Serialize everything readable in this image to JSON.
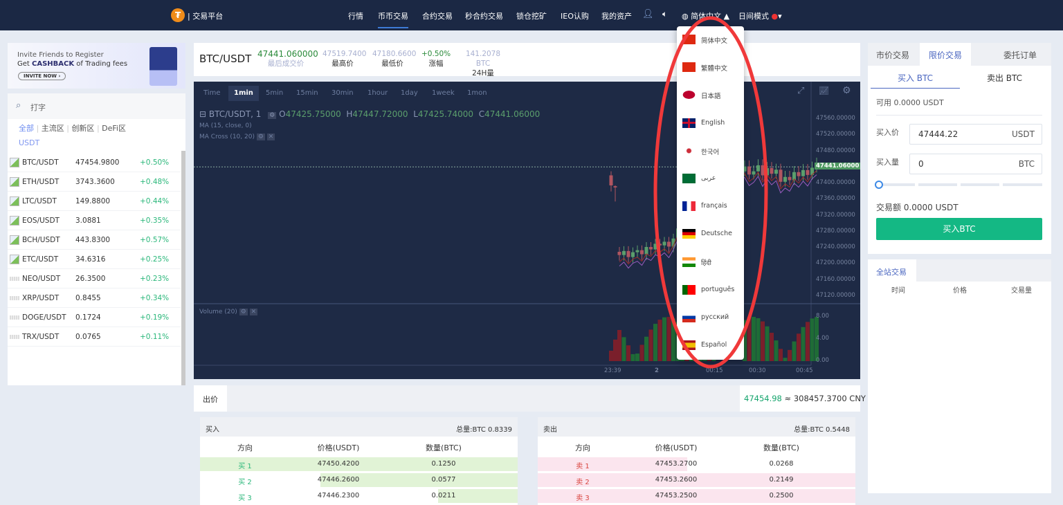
{
  "nav": {
    "brand": "| 交易平台",
    "logo_glyph": "₮",
    "items": [
      "行情",
      "币币交易",
      "合约交易",
      "秒合约交易",
      "锁仓挖矿",
      "IEO认购",
      "我的资产"
    ],
    "active": 1,
    "language": "简体中文",
    "theme": "日间模式"
  },
  "banner": {
    "line1": "Invite Friends to Register",
    "line2_pre": "Get ",
    "line2_bold": "CASHBACK",
    "line2_post": " of Trading fees",
    "button": "INVITE NOW ›"
  },
  "market": {
    "search_placeholder": "打字",
    "tabs": [
      "全部",
      "主流区",
      "创新区",
      "DeFi区",
      "USDT"
    ],
    "active_tab": 0,
    "rows": [
      {
        "pair": "BTC/USDT",
        "price": "47454.9800",
        "change": "+0.50%",
        "icon": "broken"
      },
      {
        "pair": "ETH/USDT",
        "price": "3743.3600",
        "change": "+0.48%",
        "icon": "broken"
      },
      {
        "pair": "LTC/USDT",
        "price": "149.8800",
        "change": "+0.44%",
        "icon": "broken"
      },
      {
        "pair": "EOS/USDT",
        "price": "3.0881",
        "change": "+0.35%",
        "icon": "broken"
      },
      {
        "pair": "BCH/USDT",
        "price": "443.8300",
        "change": "+0.57%",
        "icon": "broken"
      },
      {
        "pair": "ETC/USDT",
        "price": "34.6316",
        "change": "+0.25%",
        "icon": "broken"
      },
      {
        "pair": "NEO/USDT",
        "price": "26.3500",
        "change": "+0.23%",
        "icon": "blurred"
      },
      {
        "pair": "XRP/USDT",
        "price": "0.8455",
        "change": "+0.34%",
        "icon": "blurred"
      },
      {
        "pair": "DOGE/USDT",
        "price": "0.1724",
        "change": "+0.19%",
        "icon": "blurred"
      },
      {
        "pair": "TRX/USDT",
        "price": "0.0765",
        "change": "+0.11%",
        "icon": "blurred"
      }
    ]
  },
  "ticker": {
    "pair": "BTC/USDT",
    "last": "47441.060000",
    "last_label": "最后成交价",
    "high": "47519.7400",
    "high_label": "最高价",
    "low": "47180.6600",
    "low_label": "最低价",
    "change": "+0.50%",
    "change_label": "涨幅",
    "volume": "141.2078 BTC",
    "volume_label": "24H量"
  },
  "chart": {
    "timeframes": [
      "Time",
      "1min",
      "5min",
      "15min",
      "30min",
      "1hour",
      "1day",
      "1week",
      "1mon"
    ],
    "active_tf": 1,
    "legend_title": "BTC/USDT, 1",
    "o": "47425.75000",
    "h": "47447.72000",
    "l": "47425.74000",
    "c": "47441.06000",
    "ma": "MA (15, close, 0)",
    "ma_cross": "MA Cross (10, 20)",
    "volume_label": "Volume (20)",
    "price_ticks": [
      "47560.00000",
      "47520.00000",
      "47480.00000",
      "47441.06000",
      "47400.00000",
      "47360.00000",
      "47320.00000",
      "47280.00000",
      "47240.00000",
      "47200.00000",
      "47160.00000",
      "47120.00000"
    ],
    "volume_ticks": [
      "8.00",
      "4.00",
      "0.00"
    ],
    "time_ticks": [
      "23:39",
      "2",
      "00:15",
      "00:30",
      "00:45"
    ],
    "current_price": 47441.06,
    "up_color": "#5b9e6c",
    "down_color": "#b05560"
  },
  "orderbook": {
    "label": "出价",
    "price": "47454.98",
    "cny": "≈ 308457.3700 CNY",
    "buy": {
      "title": "买入",
      "total": "总量:BTC 0.8339",
      "cols": [
        "方向",
        "价格(USDT)",
        "数量(BTC)"
      ],
      "rows": [
        {
          "side": "买 1",
          "price": "47450.4200",
          "qty": "0.1250",
          "depth": 1.0
        },
        {
          "side": "买 2",
          "price": "47446.2600",
          "qty": "0.0577",
          "depth": 0.62
        },
        {
          "side": "买 3",
          "price": "47446.2300",
          "qty": "0.0211",
          "depth": 0.25
        }
      ]
    },
    "sell": {
      "title": "卖出",
      "total": "总量:BTC 0.5448",
      "cols": [
        "方向",
        "价格(USDT)",
        "数量(BTC)"
      ],
      "rows": [
        {
          "side": "卖 1",
          "price": "47453.2700",
          "qty": "0.0268",
          "depth": 0.47
        },
        {
          "side": "卖 2",
          "price": "47453.2600",
          "qty": "0.2149",
          "depth": 1.0
        },
        {
          "side": "卖 3",
          "price": "47453.2500",
          "qty": "0.2500",
          "depth": 1.0
        }
      ]
    }
  },
  "trade": {
    "tabs": [
      "市价交易",
      "限价交易",
      "委托订单"
    ],
    "active_tab": 1,
    "sides": [
      "买入 BTC",
      "卖出 BTC"
    ],
    "available": "可用 0.0000 USDT",
    "price_label": "买入价",
    "price_value": "47444.22",
    "price_unit": "USDT",
    "qty_label": "买入量",
    "qty_value": "0",
    "qty_unit": "BTC",
    "slider_value": 0,
    "amount": "交易额 0.0000 USDT",
    "submit": "买入BTC",
    "submit_color": "#14b884"
  },
  "trades": {
    "tab": "全站交易",
    "cols": [
      "时间",
      "价格",
      "交易量"
    ]
  },
  "languages": [
    {
      "label": "简体中文",
      "flag": "cn"
    },
    {
      "label": "繁體中文",
      "flag": "hk"
    },
    {
      "label": "日本語",
      "flag": "jp"
    },
    {
      "label": "English",
      "flag": "gb"
    },
    {
      "label": "한국어",
      "flag": "kr"
    },
    {
      "label": "عربى",
      "flag": "sa"
    },
    {
      "label": "français",
      "flag": "fr"
    },
    {
      "label": "Deutsche",
      "flag": "de"
    },
    {
      "label": "हिंदी",
      "flag": "in"
    },
    {
      "label": "português",
      "flag": "pt"
    },
    {
      "label": "русский",
      "flag": "ru"
    },
    {
      "label": "Español",
      "flag": "es"
    }
  ]
}
